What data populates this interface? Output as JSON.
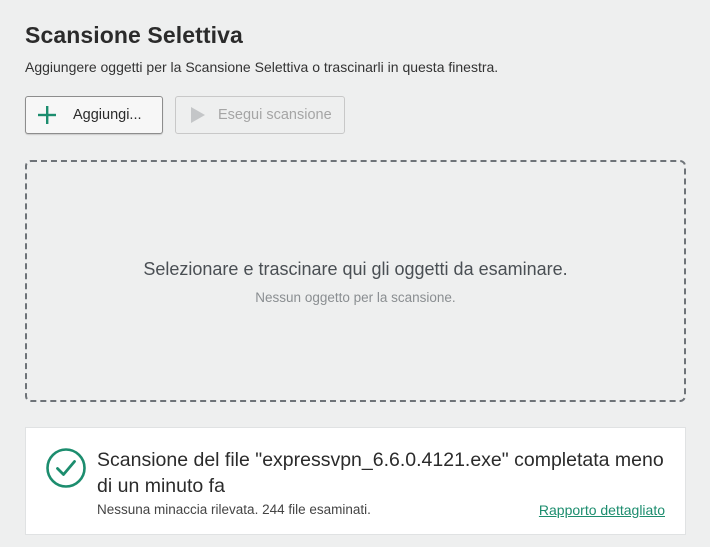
{
  "header": {
    "title": "Scansione Selettiva",
    "subtitle": "Aggiungere oggetti per la Scansione Selettiva o trascinarli in questa finestra."
  },
  "toolbar": {
    "add_label": "Aggiungi...",
    "add_icon": "plus-icon",
    "scan_label": "Esegui scansione",
    "scan_icon": "play-icon",
    "scan_enabled": false
  },
  "dropzone": {
    "main_text": "Selezionare e trascinare qui gli oggetti da esaminare.",
    "sub_text": "Nessun oggetto per la scansione."
  },
  "status": {
    "icon": "check-circle-icon",
    "title": "Scansione del file \"expressvpn_6.6.0.4121.exe\" completata meno di un minuto fa",
    "detail": "Nessuna minaccia rilevata. 244 file esaminati.",
    "link_label": "Rapporto dettagliato"
  },
  "colors": {
    "accent": "#1c8d6e",
    "background": "#eeefef",
    "card": "#ffffff"
  }
}
